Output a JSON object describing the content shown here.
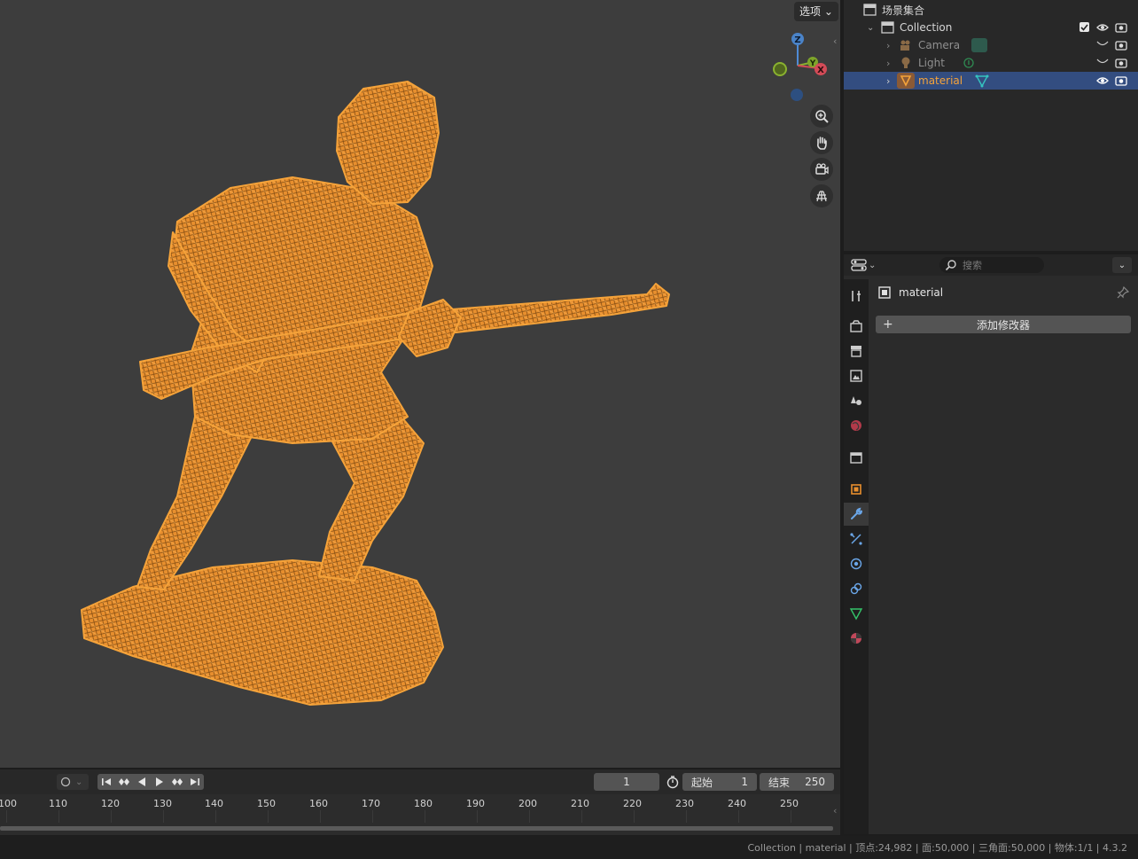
{
  "viewport": {
    "options_label": "选项",
    "gizmo": {
      "z": "Z",
      "y": "Y",
      "x": "X"
    },
    "nav_icons": [
      "zoom-icon",
      "hand-icon",
      "camera-icon",
      "grid-icon"
    ],
    "accent": "#f5a33a"
  },
  "timeline": {
    "current_frame": "1",
    "start_label": "起始",
    "start_value": "1",
    "end_label": "结束",
    "end_value": "250",
    "ticks": [
      "100",
      "110",
      "120",
      "130",
      "140",
      "150",
      "160",
      "170",
      "180",
      "190",
      "200",
      "210",
      "220",
      "230",
      "240",
      "250"
    ]
  },
  "outliner": {
    "scene_collection": "场景集合",
    "collection": "Collection",
    "items": [
      {
        "label": "Camera"
      },
      {
        "label": "Light"
      },
      {
        "label": "material"
      }
    ],
    "selected_color": "#334d80"
  },
  "properties": {
    "search_placeholder": "搜索",
    "object_name": "material",
    "add_modifier": "添加修改器"
  },
  "statusbar": {
    "text": "Collection | material | 顶点:24,982 | 面:50,000 | 三角面:50,000 | 物体:1/1 | 4.3.2"
  }
}
